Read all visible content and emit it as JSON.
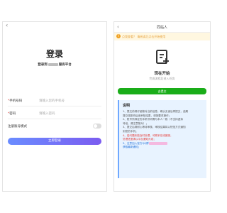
{
  "login": {
    "title": "登录",
    "subtitle_prefix": "登录到",
    "subtitle_suffix": "服务平台",
    "phone_label": "手机号码",
    "phone_placeholder": "请输入您的手机号",
    "password_label": "密码",
    "password_placeholder": "请输入密码",
    "remember_label": "注册账号模式",
    "login_button": "立即登录"
  },
  "flow": {
    "title": "同站人",
    "notice": "点我查看？ 请阅读后点击开始使用",
    "start_title": "现在开始",
    "start_sub": "完成流程后进入任务",
    "start_button": "去提交",
    "hint_heading": "说明",
    "hints": [
      {
        "style": "normal",
        "text": "1、提交前请仔细核对当前信息，确认无误后再提交，逾期"
      },
      {
        "style": "normal",
        "text": "提交将影响后续审核结果，请按要求操作；"
      },
      {
        "style": "normal",
        "text": "2、账号所绑定的手机号码需与本人一致（不支持虚拟"
      },
      {
        "style": "normal",
        "text": "号段，请注意核对）；"
      },
      {
        "style": "normal",
        "text": "3、提交后请耐心等待审核，审核结果将以短信方式通知"
      },
      {
        "style": "normal",
        "text": "到您的手机；"
      },
      {
        "style": "red",
        "text": "4、若问题未能及时处理，可联系在线客服，"
      },
      {
        "style": "red",
        "text": "处理进度请以平台通知为准；"
      },
      {
        "style": "blue",
        "text": "5、注意加入官方QQ群"
      },
      {
        "style": "blue",
        "text": "获取最新通知；"
      }
    ]
  },
  "colors": {
    "accent_green": "#1aad19",
    "accent_blue": "#6a8cff",
    "notice_orange": "#e6a23c"
  }
}
